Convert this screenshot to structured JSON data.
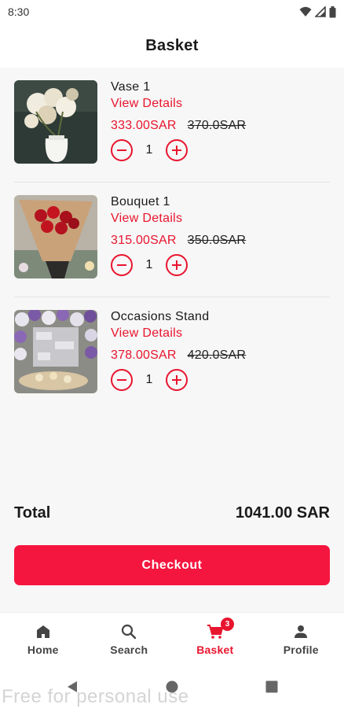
{
  "status_bar": {
    "time": "8:30",
    "icons": [
      "wifi-icon",
      "signal-icon",
      "battery-icon"
    ]
  },
  "header": {
    "title": "Basket"
  },
  "cart": {
    "items": [
      {
        "name": "Vase 1",
        "details_label": "View Details",
        "price": "333.00SAR",
        "old_price": "370.0SAR",
        "quantity": "1",
        "image": "vase-flowers-photo"
      },
      {
        "name": "Bouquet 1",
        "details_label": "View Details",
        "price": "315.00SAR",
        "old_price": "350.0SAR",
        "quantity": "1",
        "image": "bouquet-roses-photo"
      },
      {
        "name": "Occasions Stand",
        "details_label": "View Details",
        "price": "378.00SAR",
        "old_price": "420.0SAR",
        "quantity": "1",
        "image": "occasions-stand-photo"
      }
    ],
    "total_label": "Total",
    "total_value": "1041.00 SAR",
    "checkout_label": "Checkout"
  },
  "bottom_nav": {
    "items": [
      {
        "label": "Home",
        "icon": "home-icon"
      },
      {
        "label": "Search",
        "icon": "search-icon"
      },
      {
        "label": "Basket",
        "icon": "cart-icon",
        "badge": "3",
        "active": true
      },
      {
        "label": "Profile",
        "icon": "person-icon"
      }
    ]
  },
  "system_nav": {
    "buttons": [
      "back-icon",
      "home-circle-icon",
      "recents-icon"
    ]
  },
  "watermark": "Free for personal use",
  "colors": {
    "accent": "#e8152e",
    "checkout_button": "#f5163f",
    "background": "#f7f7f7"
  }
}
